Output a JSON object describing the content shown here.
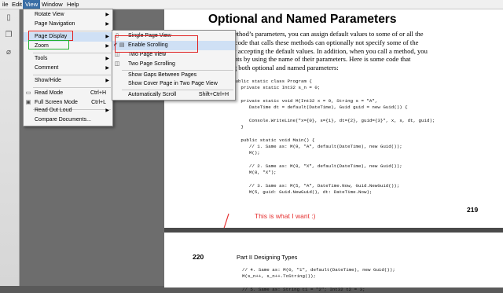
{
  "menubar": {
    "items": [
      {
        "label": "ile",
        "active": false
      },
      {
        "label": "Edit",
        "active": false
      },
      {
        "label": "View",
        "active": true
      },
      {
        "label": "Window",
        "active": false
      },
      {
        "label": "Help",
        "active": false
      }
    ]
  },
  "view_menu": {
    "items": [
      {
        "label": "Rotate View",
        "shortcut": "",
        "submenu": true
      },
      {
        "label": "Page Navigation",
        "shortcut": "",
        "submenu": true
      },
      {
        "label": "Page Display",
        "shortcut": "",
        "submenu": true,
        "highlighted": true
      },
      {
        "label": "Zoom",
        "shortcut": "",
        "submenu": true
      },
      {
        "label": "Tools",
        "shortcut": "",
        "submenu": true
      },
      {
        "label": "Comment",
        "shortcut": "",
        "submenu": true
      },
      {
        "label": "Show/Hide",
        "shortcut": "",
        "submenu": true
      },
      {
        "label": "Read Mode",
        "shortcut": "Ctrl+H",
        "submenu": false
      },
      {
        "label": "Full Screen Mode",
        "shortcut": "Ctrl+L",
        "submenu": false
      },
      {
        "label": "Read Out Loud",
        "shortcut": "",
        "submenu": true
      },
      {
        "label": "Compare Documents...",
        "shortcut": "",
        "submenu": false
      }
    ]
  },
  "page_display_menu": {
    "items": [
      {
        "label": "Single Page View",
        "shortcut": ""
      },
      {
        "label": "Enable Scrolling",
        "shortcut": "",
        "checked": true,
        "highlighted": true
      },
      {
        "label": "Two Page View",
        "shortcut": ""
      },
      {
        "label": "Two Page Scrolling",
        "shortcut": ""
      },
      {
        "label": "Show Gaps Between Pages",
        "shortcut": ""
      },
      {
        "label": "Show Cover Page in Two Page View",
        "shortcut": ""
      },
      {
        "label": "Automatically Scroll",
        "shortcut": "Shift+Ctrl+H"
      }
    ]
  },
  "document": {
    "title": "Optional and Named Parameters",
    "paragraph": [
      "hen designing a method’s parameters, you can assign default values to some of or all the",
      "parameters. Then, code that calls these methods can optionally not specify some of the",
      "arguments, thereby accepting the default values. In addition, when you call a method, you",
      "an specify arguments by using the name of their parameters. Here is some code that",
      "demonstrates using both optional and named parameters:"
    ],
    "code_page1": [
      "public static class Program {",
      "   private static Int32 s_n = 0;",
      "",
      "   private static void M(Int32 x = 9, String s = \"A\",",
      "      DateTime dt = default(DateTime), Guid guid = new Guid()) {",
      "",
      "      Console.WriteLine(\"x={0}, s={1}, dt={2}, guid={3}\", x, s, dt, guid);",
      "   }",
      "",
      "   public static void Main() {",
      "      // 1. Same as: M(9, \"A\", default(DateTime), new Guid());",
      "      M();",
      "",
      "      // 2. Same as: M(8, \"X\", default(DateTime), new Guid());",
      "      M(8, \"X\");",
      "",
      "      // 3. Same as: M(5, \"A\", DateTime.Now, Guid.NewGuid());",
      "      M(5, guid: Guid.NewGuid(), dt: DateTime.Now);"
    ],
    "page1_number": "219",
    "annotation": "This is what I want :)",
    "page2_number": "220",
    "page2_header": "Part II   Designing Types",
    "code_page2": [
      "// 4. Same as: M(0, \"1\", default(DateTime), new Guid());",
      "M(s_n++, s_n++.ToString());",
      "",
      "// 5. Same as: String t1 = \"2\"; Int32 t2 = 3;"
    ]
  },
  "colors": {
    "menu_active": "#3a6ea5",
    "annotation": "#e53030",
    "highlight_box": "#e02020",
    "zoom_box": "#22b030"
  }
}
